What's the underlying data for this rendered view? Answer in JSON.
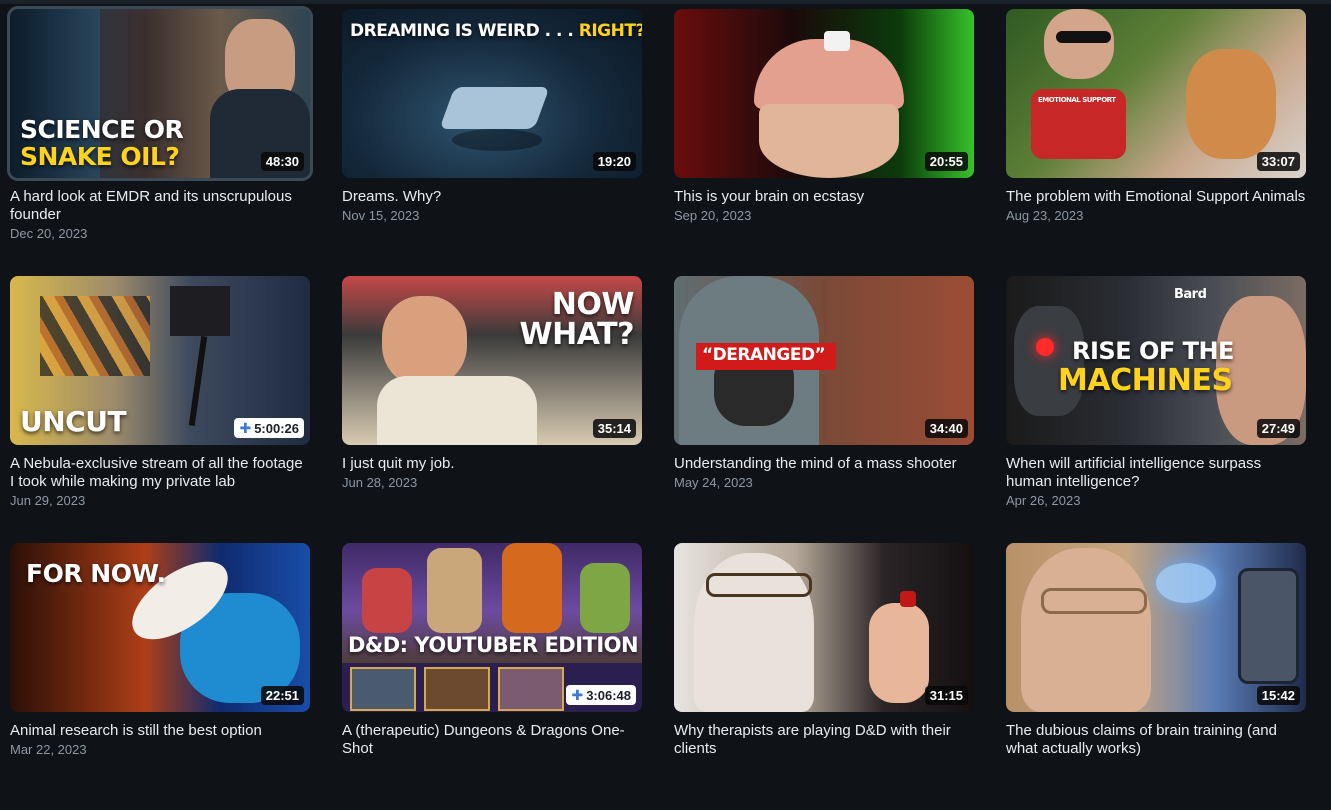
{
  "videos": [
    {
      "title": "A hard look at EMDR and its unscrupulous founder",
      "date": "Dec 20, 2023",
      "duration": "48:30",
      "nebula": false,
      "overlay": "SCIENCE OR",
      "overlay2": "SNAKE OIL?"
    },
    {
      "title": "Dreams. Why?",
      "date": "Nov 15, 2023",
      "duration": "19:20",
      "nebula": false,
      "overlay": "DREAMING IS WEIRD . . . ",
      "overlay2": "RIGHT?"
    },
    {
      "title": "This is your brain on ecstasy",
      "date": "Sep 20, 2023",
      "duration": "20:55",
      "nebula": false
    },
    {
      "title": "The problem with Emotional Support Animals",
      "date": "Aug 23, 2023",
      "duration": "33:07",
      "nebula": false,
      "overlay": "EMOTIONAL SUPPORT"
    },
    {
      "title": "A Nebula-exclusive stream of all the footage I took while making my private lab",
      "date": "Jun 29, 2023",
      "duration": "5:00:26",
      "nebula": true,
      "overlay": "UNCUT"
    },
    {
      "title": "I just quit my job.",
      "date": "Jun 28, 2023",
      "duration": "35:14",
      "nebula": false,
      "overlay": "NOW",
      "overlay2": "WHAT?"
    },
    {
      "title": "Understanding the mind of a mass shooter",
      "date": "May 24, 2023",
      "duration": "34:40",
      "nebula": false,
      "overlay": "“DERANGED”"
    },
    {
      "title": "When will artificial intelligence surpass human intelligence?",
      "date": "Apr 26, 2023",
      "duration": "27:49",
      "nebula": false,
      "overlay": "RISE OF THE",
      "overlay2": "MACHINES",
      "overlay3": "Bard"
    },
    {
      "title": "Animal research is still the best option",
      "date": "Mar 22, 2023",
      "duration": "22:51",
      "nebula": false,
      "overlay": "FOR NOW."
    },
    {
      "title": "A (therapeutic) Dungeons & Dragons One-Shot",
      "date": "",
      "duration": "3:06:48",
      "nebula": true,
      "overlay": "D&D: YOUTUBER EDITION"
    },
    {
      "title": "Why therapists are playing D&D with their clients",
      "date": "",
      "duration": "31:15",
      "nebula": false
    },
    {
      "title": "The dubious claims of brain training (and what actually works)",
      "date": "",
      "duration": "15:42",
      "nebula": false
    }
  ],
  "colors": {
    "background": "#0f1216",
    "title_text": "#e9edf1",
    "date_text": "#8e98a3",
    "accent_yellow": "#ffd21e",
    "nebula_plus": "#3a7bd5"
  }
}
